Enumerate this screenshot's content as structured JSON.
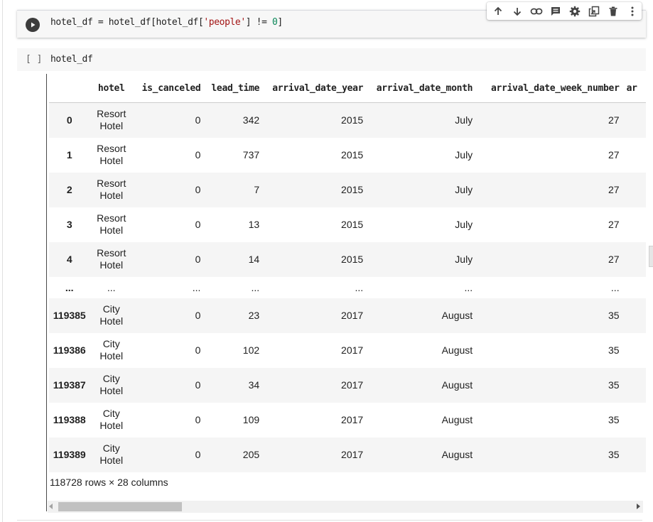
{
  "cell1": {
    "run_label": "Run cell",
    "code": {
      "p1": "hotel_df = hotel_df[hotel_df[",
      "str": "'people'",
      "p2": "] != ",
      "num": "0",
      "p3": "]"
    }
  },
  "toolbar": {
    "icons": [
      "arrow-up-icon",
      "arrow-down-icon",
      "link-icon",
      "comment-icon",
      "gear-icon",
      "mirror-cell-icon",
      "trash-icon",
      "more-vert-icon"
    ]
  },
  "cell2": {
    "prompt": "[ ]",
    "code": "hotel_df"
  },
  "dataframe": {
    "columns": [
      "hotel",
      "is_canceled",
      "lead_time",
      "arrival_date_year",
      "arrival_date_month",
      "arrival_date_week_number",
      "ar"
    ],
    "rows": [
      {
        "index": "0",
        "hotel_a": "Resort",
        "hotel_b": "Hotel",
        "is_canceled": "0",
        "lead_time": "342",
        "year": "2015",
        "month": "July",
        "week": "27"
      },
      {
        "index": "1",
        "hotel_a": "Resort",
        "hotel_b": "Hotel",
        "is_canceled": "0",
        "lead_time": "737",
        "year": "2015",
        "month": "July",
        "week": "27"
      },
      {
        "index": "2",
        "hotel_a": "Resort",
        "hotel_b": "Hotel",
        "is_canceled": "0",
        "lead_time": "7",
        "year": "2015",
        "month": "July",
        "week": "27"
      },
      {
        "index": "3",
        "hotel_a": "Resort",
        "hotel_b": "Hotel",
        "is_canceled": "0",
        "lead_time": "13",
        "year": "2015",
        "month": "July",
        "week": "27"
      },
      {
        "index": "4",
        "hotel_a": "Resort",
        "hotel_b": "Hotel",
        "is_canceled": "0",
        "lead_time": "14",
        "year": "2015",
        "month": "July",
        "week": "27"
      },
      {
        "index": "119385",
        "hotel_a": "City",
        "hotel_b": "Hotel",
        "is_canceled": "0",
        "lead_time": "23",
        "year": "2017",
        "month": "August",
        "week": "35"
      },
      {
        "index": "119386",
        "hotel_a": "City",
        "hotel_b": "Hotel",
        "is_canceled": "0",
        "lead_time": "102",
        "year": "2017",
        "month": "August",
        "week": "35"
      },
      {
        "index": "119387",
        "hotel_a": "City",
        "hotel_b": "Hotel",
        "is_canceled": "0",
        "lead_time": "34",
        "year": "2017",
        "month": "August",
        "week": "35"
      },
      {
        "index": "119388",
        "hotel_a": "City",
        "hotel_b": "Hotel",
        "is_canceled": "0",
        "lead_time": "109",
        "year": "2017",
        "month": "August",
        "week": "35"
      },
      {
        "index": "119389",
        "hotel_a": "City",
        "hotel_b": "Hotel",
        "is_canceled": "0",
        "lead_time": "205",
        "year": "2017",
        "month": "August",
        "week": "35"
      }
    ],
    "ellipsis": "...",
    "shape": "118728 rows × 28 columns"
  }
}
